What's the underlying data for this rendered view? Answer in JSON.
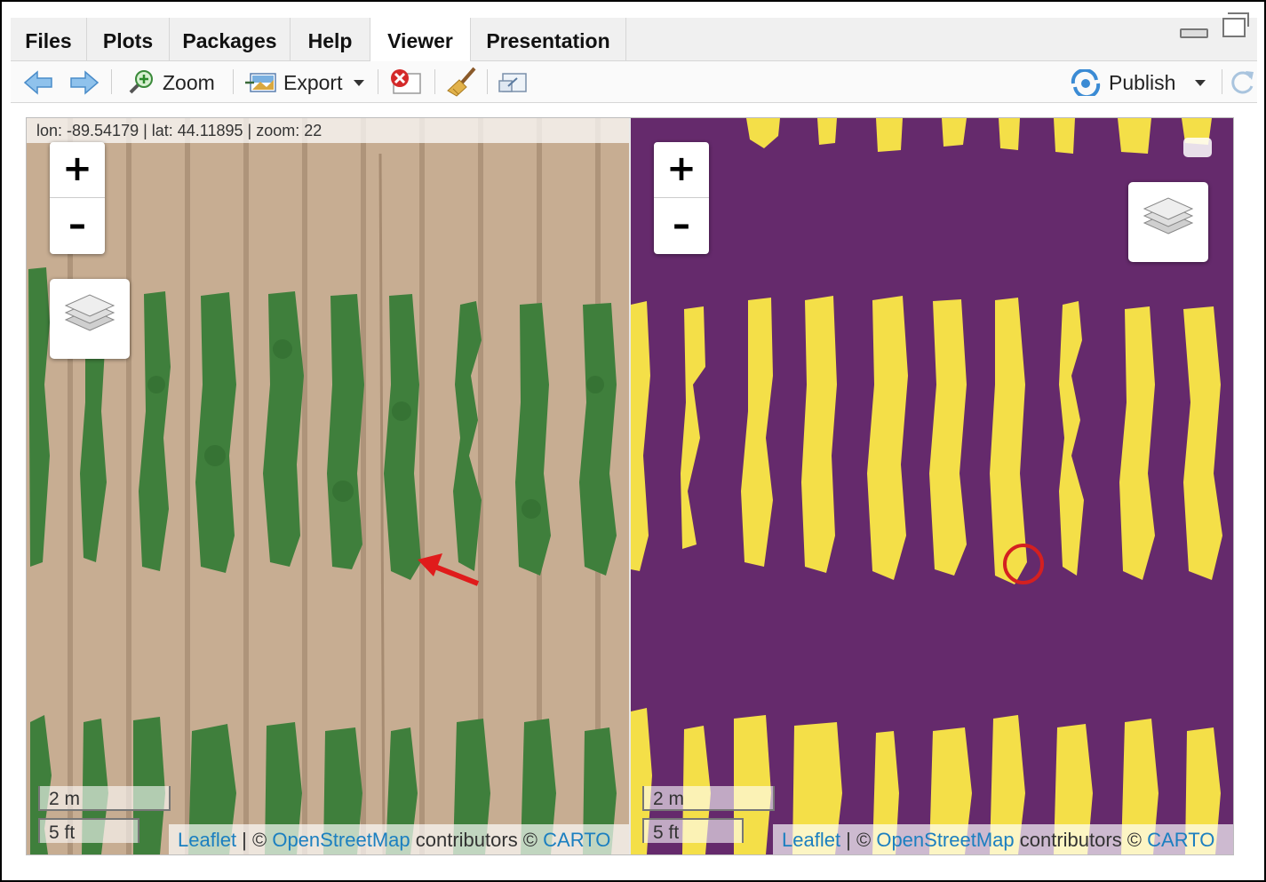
{
  "tabs": [
    {
      "label": "Files",
      "active": false
    },
    {
      "label": "Plots",
      "active": false
    },
    {
      "label": "Packages",
      "active": false
    },
    {
      "label": "Help",
      "active": false
    },
    {
      "label": "Viewer",
      "active": true
    },
    {
      "label": "Presentation",
      "active": false
    }
  ],
  "toolbar": {
    "zoom_label": "Zoom",
    "export_label": "Export",
    "publish_label": "Publish"
  },
  "left_map": {
    "coords": "lon: -89.54179 | lat: 44.11895 | zoom: 22",
    "zoom_in": "+",
    "zoom_out": "–",
    "scale_metric": "2 m",
    "scale_imperial": "5 ft",
    "attribution": {
      "leaflet": "Leaflet",
      "sep": " | © ",
      "osm": "OpenStreetMap",
      "contrib": " contributors © ",
      "carto": "CARTO"
    }
  },
  "right_map": {
    "zoom_in": "+",
    "zoom_out": "–",
    "scale_metric": "2 m",
    "scale_imperial": "5 ft",
    "attribution": {
      "leaflet": "Leaflet",
      "sep": " | © ",
      "osm": "OpenStreetMap",
      "contrib": " contributors © ",
      "carto": "CARTO"
    }
  },
  "colors": {
    "soil": "#c7ad92",
    "crop_green": "#3f7f3c",
    "mask_purple": "#652a6c",
    "mask_yellow": "#f4df48",
    "link_blue": "#1b7fc0",
    "annotation_red": "#e01b1b"
  },
  "icons": [
    "back-arrow-icon",
    "forward-arrow-icon",
    "zoom-icon",
    "export-icon",
    "stop-icon",
    "broom-icon",
    "popout-icon",
    "publish-icon",
    "refresh-icon",
    "layers-icon"
  ]
}
